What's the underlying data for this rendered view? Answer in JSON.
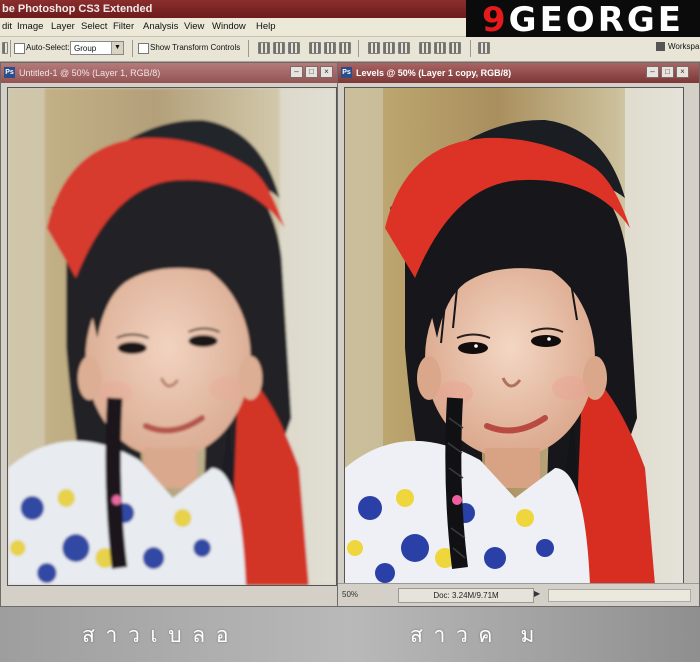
{
  "app": {
    "title": "be Photoshop CS3 Extended"
  },
  "logo": {
    "prefix": "9",
    "text": "GEORGE"
  },
  "menu": [
    "dit",
    "Image",
    "Layer",
    "Select",
    "Filter",
    "Analysis",
    "View",
    "Window",
    "Help"
  ],
  "options": {
    "auto_select_label": "Auto-Select:",
    "auto_select_value": "Group",
    "transform_label": "Show Transform Controls",
    "workspace_label": "Workspa"
  },
  "windows": {
    "left": {
      "title": "Untitled-1 @ 50% (Layer 1, RGB/8)"
    },
    "right": {
      "title": "Levels @ 50% (Layer 1 copy, RGB/8)",
      "zoom": "50%",
      "doc_size": "Doc: 3.24M/9.71M"
    }
  },
  "captions": {
    "left": "ส า ว เ บ ล อ",
    "right": "ส า ว ค   ม"
  },
  "colors": {
    "title_bar": "#7a2424",
    "logo_bg": "#0b0b0b",
    "logo_accent": "#e31b1b",
    "scarf_red": "#d63a2e",
    "scarf_black": "#1e2226"
  }
}
